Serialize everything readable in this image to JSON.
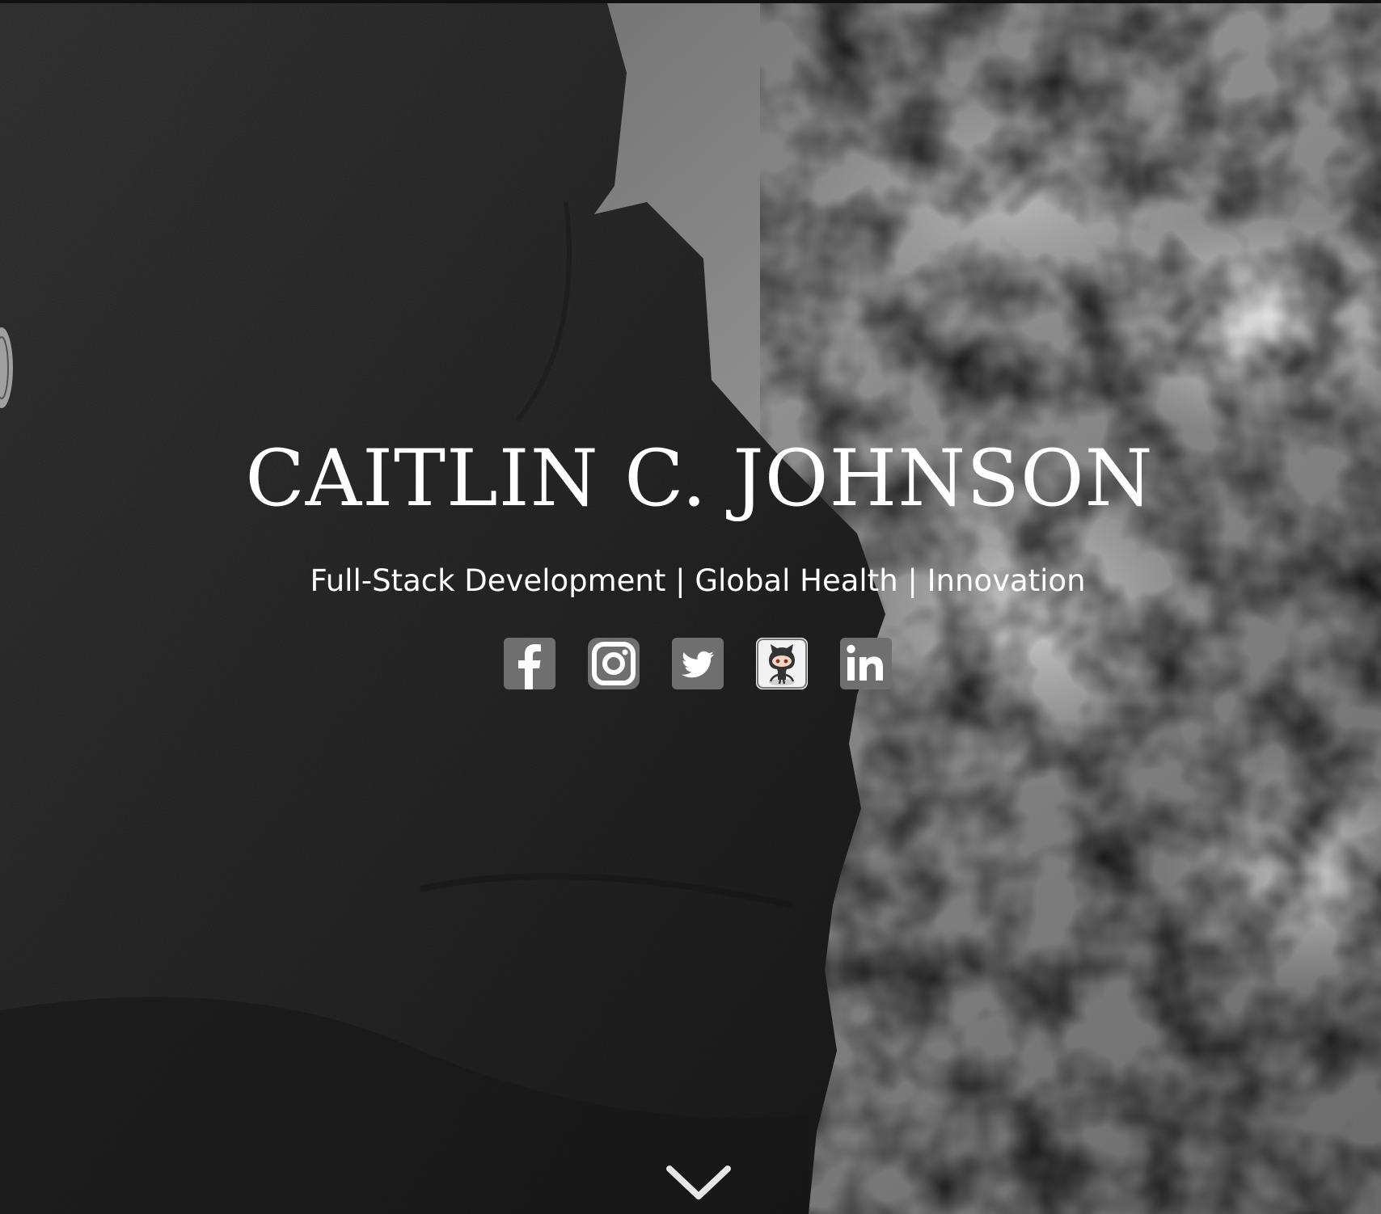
{
  "hero": {
    "name": "CAITLIN C. JOHNSON",
    "tagline": "Full-Stack Development | Global Health | Innovation"
  },
  "social_links": [
    {
      "network": "Facebook",
      "icon": "facebook-icon"
    },
    {
      "network": "Instagram",
      "icon": "instagram-icon"
    },
    {
      "network": "Twitter",
      "icon": "twitter-icon"
    },
    {
      "network": "GitHub",
      "icon": "github-octocat-icon"
    },
    {
      "network": "LinkedIn",
      "icon": "linkedin-icon"
    }
  ],
  "scroll_indicator": {
    "icon": "chevron-down-icon"
  },
  "colors": {
    "text": "#ffffff",
    "icon_tile": "#6f6f6f",
    "icon_tile_light": "#f2f2f2",
    "background_rock": "#2a2a2a",
    "background_water": "#8a8a8a"
  }
}
